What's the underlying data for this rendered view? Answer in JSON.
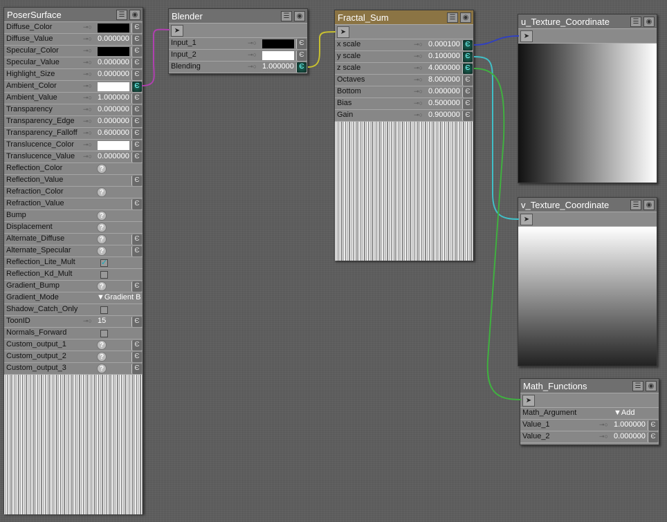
{
  "nodes": {
    "poser": {
      "title": "PoserSurface",
      "rows": [
        {
          "label": "Diffuse_Color",
          "type": "color",
          "color": "#000000",
          "plug": "off"
        },
        {
          "label": "Diffuse_Value",
          "type": "num",
          "value": "0.000000"
        },
        {
          "label": "Specular_Color",
          "type": "color",
          "color": "#000000"
        },
        {
          "label": "Specular_Value",
          "type": "num",
          "value": "0.000000"
        },
        {
          "label": "Highlight_Size",
          "type": "num",
          "value": "0.000000"
        },
        {
          "label": "Ambient_Color",
          "type": "color",
          "color": "#ffffff",
          "plug": "on"
        },
        {
          "label": "Ambient_Value",
          "type": "num",
          "value": "1.000000"
        },
        {
          "label": "Transparency",
          "type": "num",
          "value": "0.000000"
        },
        {
          "label": "Transparency_Edge",
          "type": "num",
          "value": "0.000000"
        },
        {
          "label": "Transparency_Falloff",
          "type": "num",
          "value": "0.600000"
        },
        {
          "label": "Translucence_Color",
          "type": "color",
          "color": "#ffffff"
        },
        {
          "label": "Translucence_Value",
          "type": "num",
          "value": "0.000000"
        },
        {
          "label": "Reflection_Color",
          "type": "q"
        },
        {
          "label": "Reflection_Value",
          "type": "empty"
        },
        {
          "label": "Refraction_Color",
          "type": "q"
        },
        {
          "label": "Refraction_Value",
          "type": "empty"
        },
        {
          "label": "Bump",
          "type": "q"
        },
        {
          "label": "Displacement",
          "type": "q"
        },
        {
          "label": "Alternate_Diffuse",
          "type": "q"
        },
        {
          "label": "Alternate_Specular",
          "type": "q"
        },
        {
          "label": "Reflection_Lite_Mult",
          "type": "cb",
          "checked": true
        },
        {
          "label": "Reflection_Kd_Mult",
          "type": "cb",
          "checked": false
        },
        {
          "label": "Gradient_Bump",
          "type": "q"
        },
        {
          "label": "Gradient_Mode",
          "type": "menu",
          "value": "Gradient B"
        },
        {
          "label": "Shadow_Catch_Only",
          "type": "cb",
          "checked": false
        },
        {
          "label": "ToonID",
          "type": "num",
          "value": "15"
        },
        {
          "label": "Normals_Forward",
          "type": "cb",
          "checked": false
        },
        {
          "label": "Custom_output_1",
          "type": "q"
        },
        {
          "label": "Custom_output_2",
          "type": "q"
        },
        {
          "label": "Custom_output_3",
          "type": "q"
        }
      ]
    },
    "blender": {
      "title": "Blender",
      "rows": [
        {
          "label": "Input_1",
          "type": "color",
          "color": "#000000"
        },
        {
          "label": "Input_2",
          "type": "color",
          "color": "#ffffff"
        },
        {
          "label": "Blending",
          "type": "num",
          "value": "1.000000",
          "plug": "on"
        }
      ]
    },
    "fractal": {
      "title": "Fractal_Sum",
      "rows": [
        {
          "label": "x scale",
          "type": "num",
          "value": "0.000100",
          "plug": "on"
        },
        {
          "label": "y scale",
          "type": "num",
          "value": "0.100000",
          "plug": "on"
        },
        {
          "label": "z scale",
          "type": "num",
          "value": "4.000000",
          "plug": "on"
        },
        {
          "label": "Octaves",
          "type": "num",
          "value": "8.000000"
        },
        {
          "label": "Bottom",
          "type": "num",
          "value": "0.000000"
        },
        {
          "label": "Bias",
          "type": "num",
          "value": "0.500000"
        },
        {
          "label": "Gain",
          "type": "num",
          "value": "0.900000"
        }
      ]
    },
    "utex": {
      "title": "u_Texture_Coordinate",
      "rows": []
    },
    "vtex": {
      "title": "v_Texture_Coordinate",
      "rows": []
    },
    "math": {
      "title": "Math_Functions",
      "rows": [
        {
          "label": "Math_Argument",
          "type": "menu",
          "value": "Add"
        },
        {
          "label": "Value_1",
          "type": "num",
          "value": "1.000000"
        },
        {
          "label": "Value_2",
          "type": "num",
          "value": "0.000000"
        }
      ]
    }
  },
  "wires": {
    "ambient_to_blender": "#b040b0",
    "blender_to_fractal": "#c8c030",
    "x_to_u": "#3040c0",
    "y_to_v": "#40c0c8",
    "z_to_math": "#40b040"
  }
}
